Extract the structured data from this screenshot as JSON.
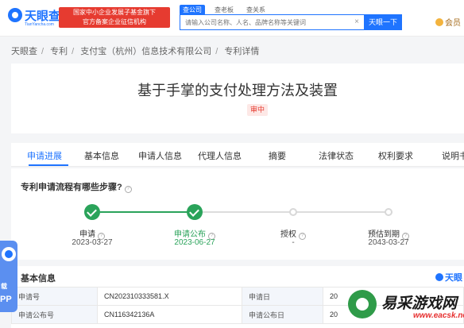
{
  "header": {
    "logo_text": "天眼查",
    "logo_sub": "TianYancha.com",
    "gov_badge_line1": "国家中小企业发展子基金旗下",
    "gov_badge_line2": "官方备案企业征信机构",
    "search_tabs": [
      "查公司",
      "查老板",
      "查关系"
    ],
    "search_placeholder": "请输入公司名称、人名、品牌名称等关键词",
    "search_clear": "×",
    "search_button": "天眼一下",
    "vip_label": "会员"
  },
  "breadcrumb": [
    "天眼查",
    "专利",
    "支付宝（杭州）信息技术有限公司",
    "专利详情"
  ],
  "patent": {
    "title": "基于手掌的支付处理方法及装置",
    "status": "审中"
  },
  "tabs": [
    "申请进展",
    "基本信息",
    "申请人信息",
    "代理人信息",
    "摘要",
    "法律状态",
    "权利要求",
    "说明书"
  ],
  "progress": {
    "question": "专利申请流程有哪些步骤?",
    "steps": [
      {
        "label": "申请",
        "date": "2023-03-27"
      },
      {
        "label": "申请公布",
        "date": "2023-06-27"
      },
      {
        "label": "授权",
        "date": "-"
      },
      {
        "label": "预估到期",
        "date": "2043-03-27"
      }
    ]
  },
  "basic_info": {
    "title": "基本信息",
    "brand": "天眼",
    "rows": [
      {
        "k1": "申请号",
        "v1": "CN202310333581.X",
        "k2": "申请日",
        "v2": "20"
      },
      {
        "k1": "申请公布号",
        "v1": "CN116342136A",
        "k2": "申请公布日",
        "v2": "20"
      }
    ]
  },
  "app_float": {
    "t1": "载",
    "t2": "PP"
  },
  "watermark": {
    "name": "易采游戏网",
    "url": "www.eacsk.net"
  },
  "colors": {
    "accent": "#1f74ff",
    "done": "#2aa35a",
    "alert": "#e63b30"
  }
}
